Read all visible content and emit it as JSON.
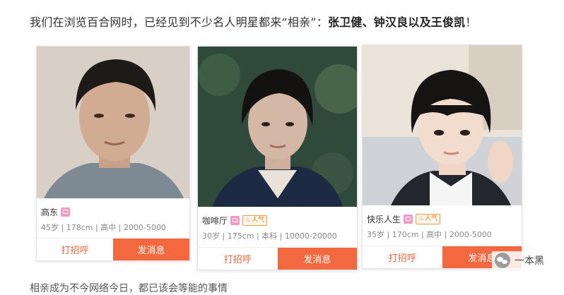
{
  "intro": {
    "prefix": "我们在浏览百合网时，已经见到不少名人明星都来“相亲”：",
    "highlight": "张卫健、钟汉良以及王俊凯",
    "suffix": "！"
  },
  "cards": [
    {
      "name": "高东",
      "hot_label": "",
      "info": "45岁 | 178cm | 高中 | 2000-5000",
      "greet": "打招呼",
      "message": "发消息"
    },
    {
      "name": "咖啡厅",
      "hot_label": "人气",
      "info": "30岁 | 175cm | 本科 | 10000-20000",
      "greet": "打招呼",
      "message": "发消息"
    },
    {
      "name": "快乐人生",
      "hot_label": "人气",
      "info": "35岁 | 170cm | 高中 | 2000-5000",
      "greet": "打招呼",
      "message": "发消息"
    }
  ],
  "watermark": {
    "text": "一本黑"
  },
  "bottom_text": "相亲成为不今网络今日，都已该会等能的事情",
  "colors": {
    "accent": "#f3683e",
    "badge_pink": "#f59ac7",
    "badge_hot": "#f07a1a"
  },
  "icons": {
    "watermark": "wechat-icon",
    "hot": "flame-icon",
    "member": "member-badge-icon"
  }
}
